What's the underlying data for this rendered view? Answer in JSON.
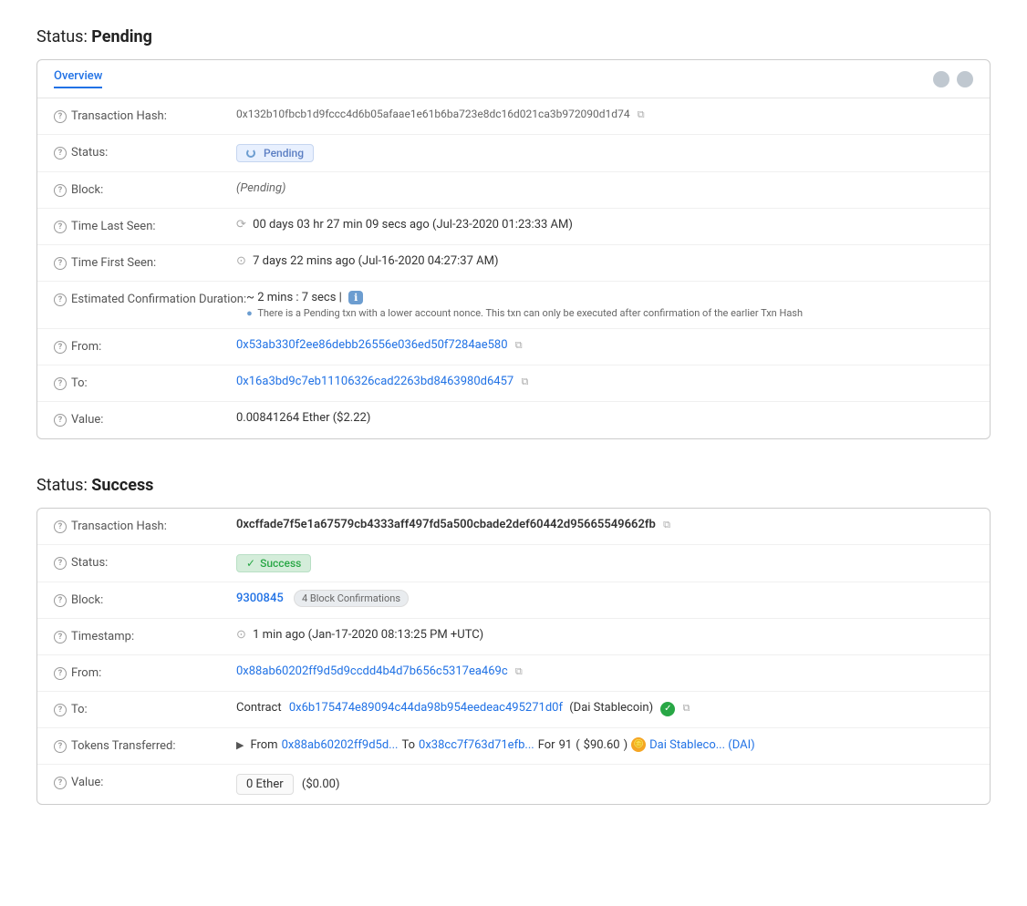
{
  "pending_section": {
    "title_prefix": "Status: ",
    "title_bold": "Pending",
    "tab_label": "Overview",
    "fields": {
      "transaction_hash": {
        "label": "Transaction Hash:",
        "value": "0x132b10fbcb1d9fccc4d6b05afaae1e61b6ba723e8dc16d021ca3b972090d1d74"
      },
      "status": {
        "label": "Status:",
        "badge": "Pending"
      },
      "block": {
        "label": "Block:",
        "value": "(Pending)"
      },
      "time_last_seen": {
        "label": "Time Last Seen:",
        "value": "00 days 03 hr 27 min 09 secs ago (Jul-23-2020 01:23:33 AM)"
      },
      "time_first_seen": {
        "label": "Time First Seen:",
        "value": "7 days 22 mins ago (Jul-16-2020 04:27:37 AM)"
      },
      "estimated_confirmation": {
        "label": "Estimated Confirmation Duration:",
        "value": "~ 2 mins : 7 secs |",
        "note": "There is a Pending txn with a lower account nonce. This txn can only be executed after confirmation of the earlier Txn Hash"
      },
      "from": {
        "label": "From:",
        "value": "0x53ab330f2ee86debb26556e036ed50f7284ae580"
      },
      "to": {
        "label": "To:",
        "value": "0x16a3bd9c7eb11106326cad2263bd8463980d6457"
      },
      "value": {
        "label": "Value:",
        "value": "0.00841264 Ether ($2.22)"
      }
    }
  },
  "success_section": {
    "title_prefix": "Status: ",
    "title_bold": "Success",
    "fields": {
      "transaction_hash": {
        "label": "Transaction Hash:",
        "value": "0xcffade7f5e1a67579cb4333aff497fd5a500cbade2def60442d95665549662fb"
      },
      "status": {
        "label": "Status:",
        "badge": "Success"
      },
      "block": {
        "label": "Block:",
        "number": "9300845",
        "confirmations": "4 Block Confirmations"
      },
      "timestamp": {
        "label": "Timestamp:",
        "value": "1 min ago (Jan-17-2020 08:13:25 PM +UTC)"
      },
      "from": {
        "label": "From:",
        "value": "0x88ab60202ff9d5d9ccdd4b4d7b656c5317ea469c"
      },
      "to": {
        "label": "To:",
        "prefix": "Contract",
        "contract_address": "0x6b175474e89094c44da98b954eedeac495271d0f",
        "contract_name": "(Dai Stablecoin)"
      },
      "tokens_transferred": {
        "label": "Tokens Transferred:",
        "from_addr": "0x88ab60202ff9d5d...",
        "to_addr": "0x38cc7f763d71efb...",
        "amount": "91",
        "usd_value": "$90.60",
        "token_name": "Dai Stableco... (DAI)"
      },
      "value": {
        "label": "Value:",
        "amount": "0 Ether",
        "usd": "($0.00)"
      }
    }
  },
  "icons": {
    "question": "?",
    "copy": "⧉",
    "clock": "①",
    "check": "✓",
    "info": "ℹ",
    "arrow": "▶"
  }
}
